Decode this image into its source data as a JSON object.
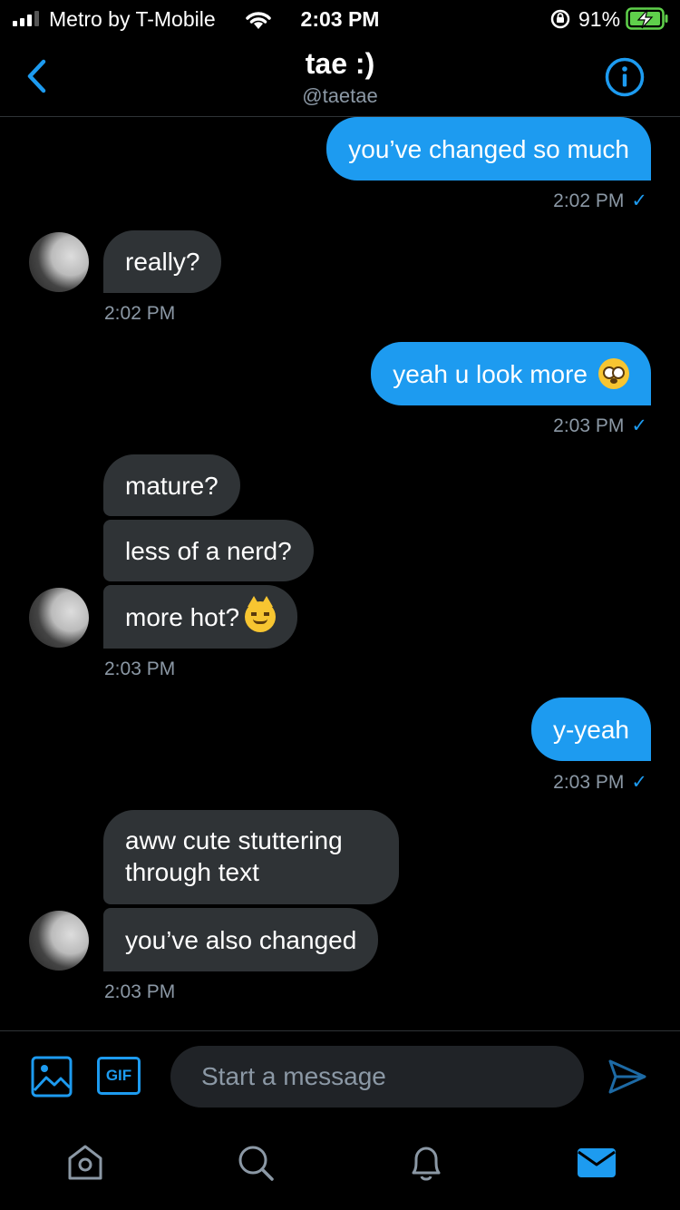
{
  "status_bar": {
    "carrier": "Metro by T-Mobile",
    "time": "2:03 PM",
    "battery_percent": "91%"
  },
  "header": {
    "title": "tae :)",
    "handle": "@taetae"
  },
  "messages": [
    {
      "direction": "out",
      "text": "you’ve changed so much"
    },
    {
      "direction": "out",
      "timestamp": "2:02 PM",
      "check": "✓"
    },
    {
      "direction": "in",
      "text": "really?"
    },
    {
      "direction": "in",
      "timestamp": "2:02 PM"
    },
    {
      "direction": "out",
      "text": "yeah u look more",
      "emoji": "flushed-face-emoji"
    },
    {
      "direction": "out",
      "timestamp": "2:03 PM",
      "check": "✓"
    },
    {
      "direction": "in",
      "text": "mature?"
    },
    {
      "direction": "in",
      "text": "less of a nerd?"
    },
    {
      "direction": "in",
      "text": "more hot?",
      "emoji": "smirking-cat-emoji"
    },
    {
      "direction": "in",
      "timestamp": "2:03 PM"
    },
    {
      "direction": "out",
      "text": "y-yeah"
    },
    {
      "direction": "out",
      "timestamp": "2:03 PM",
      "check": "✓"
    },
    {
      "direction": "in",
      "text": "aww cute stuttering through text"
    },
    {
      "direction": "in",
      "text": "you’ve also changed"
    },
    {
      "direction": "in",
      "timestamp": "2:03 PM"
    }
  ],
  "composer": {
    "gif_label": "GIF",
    "placeholder": "Start a message"
  },
  "colors": {
    "accent": "#1d9bf0",
    "incoming_bubble": "#2f3336",
    "background": "#000000",
    "muted_text": "#8b98a5"
  },
  "icons": {
    "back": "chevron-left-icon",
    "info": "info-icon",
    "image": "image-icon",
    "send": "send-icon",
    "home": "home-icon",
    "search": "search-icon",
    "notifications": "bell-icon",
    "messages": "mail-icon"
  }
}
